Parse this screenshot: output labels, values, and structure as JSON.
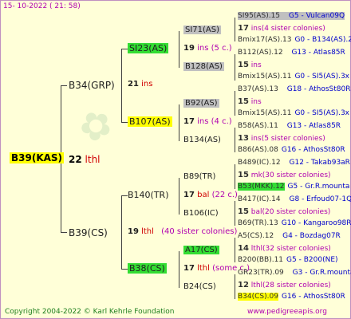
{
  "header": {
    "date": "15- 10-2022 ( 21: 58)"
  },
  "colors": {
    "green": "#33dd33",
    "yellow": "#ffff00",
    "gray": "#c0c0c0",
    "ins": "#b000b0",
    "blue": "#0000cc",
    "red": "#d00000"
  },
  "root": {
    "label": "B39(KAS)",
    "num": "22",
    "ins": "lthl"
  },
  "gen1": [
    {
      "label": "B34(GRP)",
      "num": "21",
      "ins": "ins",
      "note": ""
    },
    {
      "label": "B39(CS)",
      "num": "19",
      "ins": "lthl",
      "note": "(40 sister colonies)"
    }
  ],
  "gen2": [
    {
      "label": "SI23(AS)",
      "num": "19",
      "ins": "ins",
      "note": "(5 c.)"
    },
    {
      "label": "B107(AS)",
      "num": "17",
      "ins": "ins",
      "note": "(4 c.)"
    },
    {
      "label": "B140(TR)",
      "num": "17",
      "ins": "bal",
      "note": "(22 c.)"
    },
    {
      "label": "B38(CS)",
      "num": "17",
      "ins": "lthl",
      "note": "(some c.)"
    }
  ],
  "gen3": [
    {
      "label": "SI71(AS)",
      "num": "19",
      "ins": "ins",
      "note": "(5 c.)"
    },
    {
      "label": "B128(AS)"
    },
    {
      "label": "B92(AS)",
      "num": "17",
      "ins": "ins",
      "note": "(4 c.)"
    },
    {
      "label": "B134(AS)"
    },
    {
      "label": "B89(TR)",
      "num": "17",
      "ins": "bal",
      "note": "(22 c.)"
    },
    {
      "label": "B106(IC)"
    },
    {
      "label": "A17(CS)",
      "num": "17",
      "ins": "lthl",
      "note": "(some c.)"
    },
    {
      "label": "B24(CS)"
    }
  ],
  "gen4": [
    {
      "top": "SI95(AS).15",
      "top_code": "G5 - Vulcan09Q",
      "num": "17",
      "ins": "ins",
      "note": "(4 sister colonies)",
      "bottom": "Bmix17(AS).13",
      "bottom_code": "G0 - B134(AS).2x"
    },
    {
      "top": "B112(AS).12",
      "top_code": "G13 - Atlas85R",
      "num": "15",
      "ins": "ins",
      "note": "",
      "bottom": "Bmix15(AS).11",
      "bottom_code": "G0 - SI5(AS).3x"
    },
    {
      "top": "B37(AS).13",
      "top_code": "G18 - AthosSt80R",
      "num": "15",
      "ins": "ins",
      "note": "",
      "bottom": "Bmix15(AS).11",
      "bottom_code": "G0 - SI5(AS).3x"
    },
    {
      "top": "B58(AS).11",
      "top_code": "G13 - Atlas85R",
      "num": "13",
      "ins": "ins",
      "note": "(5 sister colonies)",
      "bottom": "B86(AS).08",
      "bottom_code": "G16 - AthosSt80R"
    },
    {
      "top": "B489(IC).12",
      "top_code": "G12 - Takab93aR",
      "num": "15",
      "ins": "mk",
      "note": "(30 sister colonies)",
      "bottom": "B53(MKK).12",
      "bottom_code": "G5 - Gr.R.mounta"
    },
    {
      "top": "B417(IC).14",
      "top_code": "G8 - Erfoud07-1Q",
      "num": "15",
      "ins": "bal",
      "note": "(20 sister colonies)",
      "bottom": "B69(TR).13",
      "bottom_code": "G10 - Kangaroo98R"
    },
    {
      "top": "A5(CS).12",
      "top_code": "G4 - Bozdag07R",
      "num": "14",
      "ins": "lthl",
      "note": "(32 sister colonies)",
      "bottom": "B200(BB).11",
      "bottom_code": "G5 - B200(NE)"
    },
    {
      "top": "GR23(TR).09",
      "top_code": "G3 - Gr.R.mounta",
      "num": "12",
      "ins": "lthl",
      "note": "(28 sister colonies)",
      "bottom": "B34(CS).09",
      "bottom_code": "G16 - AthosSt80R"
    }
  ],
  "footer": {
    "copyright": "Copyright 2004-2022 © Karl Kehrle Foundation",
    "site": "www.pedigreeapis.org"
  }
}
